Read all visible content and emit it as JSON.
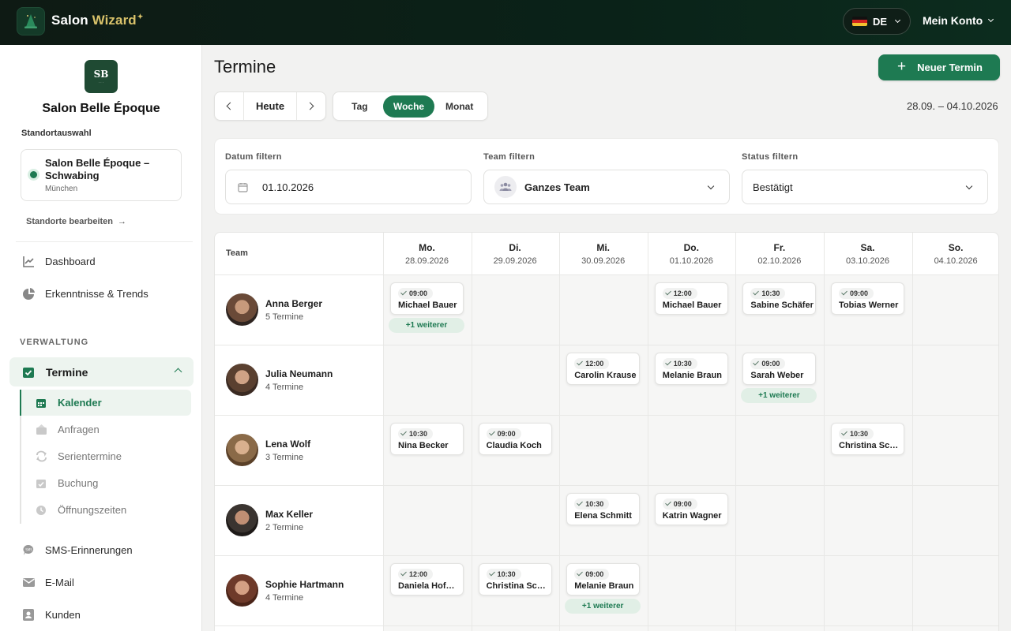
{
  "topbar": {
    "brand_a": "Salon ",
    "brand_b": "Wizard",
    "lang": "DE",
    "account": "Mein Konto"
  },
  "sidebar": {
    "salon_logo": "SB",
    "salon_name": "Salon Belle Époque",
    "location_label": "Standortauswahl",
    "location_name": "Salon Belle Époque – Schwabing",
    "location_city": "München",
    "edit_locations": "Standorte bearbeiten",
    "items_top": [
      {
        "label": "Dashboard",
        "icon": "chart-line-icon"
      },
      {
        "label": "Erkenntnisse & Trends",
        "icon": "pie-chart-icon"
      }
    ],
    "group_label": "Verwaltung",
    "active_item": "Termine",
    "sub_items": [
      {
        "label": "Kalender",
        "icon": "calendar-icon"
      },
      {
        "label": "Anfragen",
        "icon": "inbox-icon"
      },
      {
        "label": "Serientermine",
        "icon": "repeat-icon"
      },
      {
        "label": "Buchung",
        "icon": "calendar-check-icon"
      },
      {
        "label": "Öffnungszeiten",
        "icon": "clock-icon"
      }
    ],
    "items_bottom": [
      {
        "label": "SMS-Erinnerungen",
        "icon": "sms-icon"
      },
      {
        "label": "E-Mail",
        "icon": "mail-icon"
      },
      {
        "label": "Kunden",
        "icon": "contacts-icon"
      }
    ]
  },
  "main": {
    "title": "Termine",
    "new_button": "Neuer Termin",
    "today": "Heute",
    "views": [
      "Tag",
      "Woche",
      "Monat"
    ],
    "active_view": "Woche",
    "range": "28.09. – 04.10.2026"
  },
  "filters": {
    "date_label": "Datum filtern",
    "date_value": "01.10.2026",
    "team_label": "Team filtern",
    "team_value": "Ganzes Team",
    "status_label": "Status filtern",
    "status_value": "Bestätigt"
  },
  "calendar": {
    "team_header": "Team",
    "days": [
      {
        "name": "Mo.",
        "date": "28.09.2026"
      },
      {
        "name": "Di.",
        "date": "29.09.2026"
      },
      {
        "name": "Mi.",
        "date": "30.09.2026"
      },
      {
        "name": "Do.",
        "date": "01.10.2026"
      },
      {
        "name": "Fr.",
        "date": "02.10.2026"
      },
      {
        "name": "Sa.",
        "date": "03.10.2026"
      },
      {
        "name": "So.",
        "date": "04.10.2026"
      }
    ],
    "staff": [
      {
        "name": "Anna Berger",
        "count": "5 Termine",
        "tone": [
          "#6a4a38",
          "#c79a7c",
          "#2e2420"
        ],
        "appointments": [
          {
            "day": 0,
            "time": "09:00",
            "client": "Michael Bauer"
          },
          {
            "day": 3,
            "time": "12:00",
            "client": "Michael Bauer"
          },
          {
            "day": 4,
            "time": "10:30",
            "client": "Sabine Schäfer"
          },
          {
            "day": 5,
            "time": "09:00",
            "client": "Tobias Werner"
          }
        ],
        "more": [
          {
            "day": 0,
            "label": "+1 weiterer"
          }
        ]
      },
      {
        "name": "Julia Neumann",
        "count": "4 Termine",
        "tone": [
          "#5a4030",
          "#d0a386",
          "#3a2a22"
        ],
        "appointments": [
          {
            "day": 2,
            "time": "12:00",
            "client": "Carolin Krause"
          },
          {
            "day": 3,
            "time": "10:30",
            "client": "Melanie Braun"
          },
          {
            "day": 4,
            "time": "09:00",
            "client": "Sarah Weber"
          }
        ],
        "more": [
          {
            "day": 4,
            "label": "+1 weiterer"
          }
        ]
      },
      {
        "name": "Lena Wolf",
        "count": "3 Termine",
        "tone": [
          "#8a6a48",
          "#d9b08e",
          "#5a4028"
        ],
        "appointments": [
          {
            "day": 0,
            "time": "10:30",
            "client": "Nina Becker"
          },
          {
            "day": 1,
            "time": "09:00",
            "client": "Claudia Koch"
          },
          {
            "day": 5,
            "time": "10:30",
            "client": "Christina Schulz"
          }
        ],
        "more": []
      },
      {
        "name": "Max Keller",
        "count": "2 Termine",
        "tone": [
          "#3a3430",
          "#c08f74",
          "#1e1a18"
        ],
        "appointments": [
          {
            "day": 2,
            "time": "10:30",
            "client": "Elena Schmitt"
          },
          {
            "day": 3,
            "time": "09:00",
            "client": "Katrin Wagner"
          }
        ],
        "more": []
      },
      {
        "name": "Sophie Hartmann",
        "count": "4 Termine",
        "tone": [
          "#6e3a2a",
          "#d4a084",
          "#4a2418"
        ],
        "appointments": [
          {
            "day": 0,
            "time": "12:00",
            "client": "Daniela Hofmann"
          },
          {
            "day": 1,
            "time": "10:30",
            "client": "Christina Schulz"
          },
          {
            "day": 2,
            "time": "09:00",
            "client": "Melanie Braun"
          }
        ],
        "more": [
          {
            "day": 2,
            "label": "+1 weiterer"
          }
        ]
      }
    ]
  },
  "colors": {
    "accent": "#1e7a52",
    "topbar": "#0e1a14"
  }
}
